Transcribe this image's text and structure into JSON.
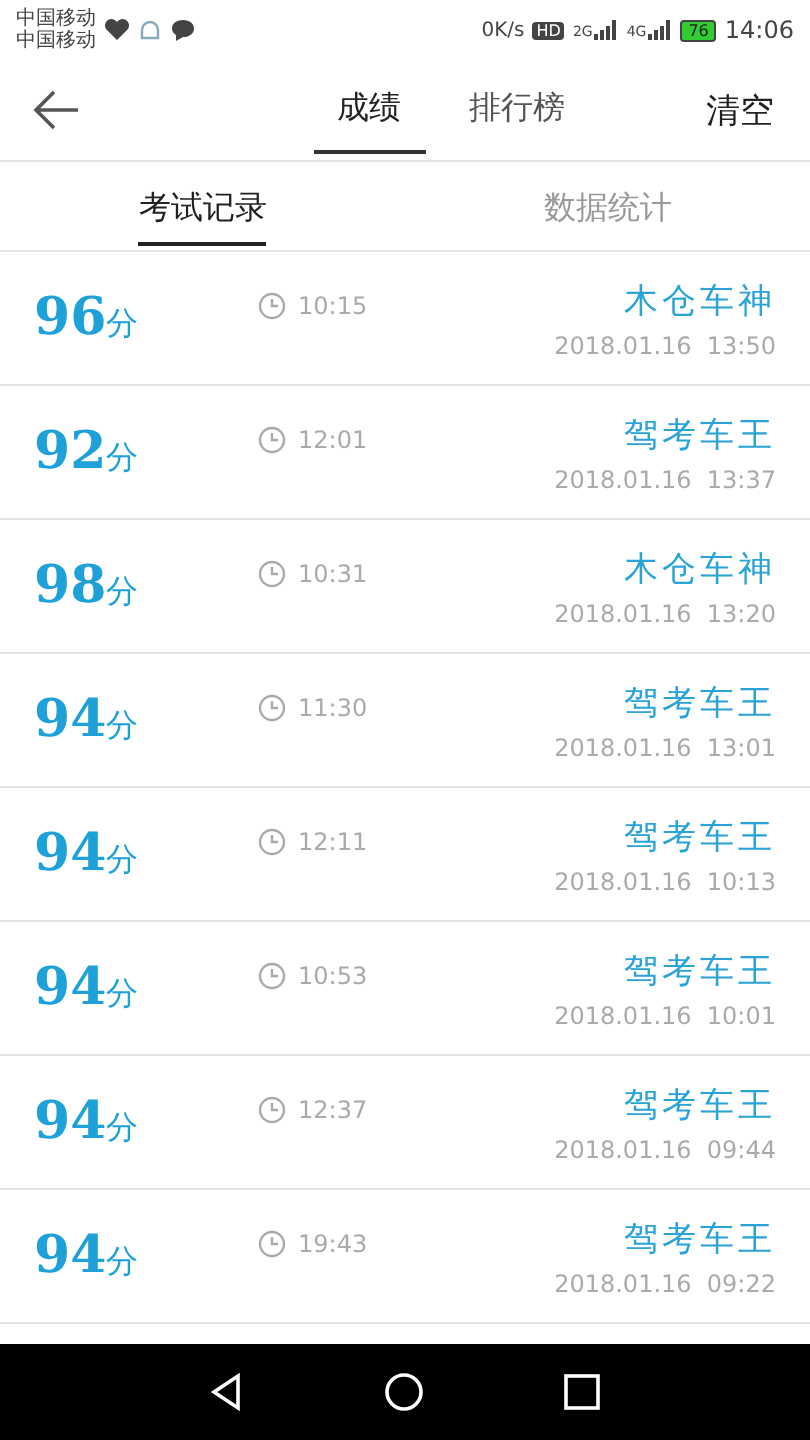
{
  "status_bar": {
    "carriers": [
      "中国移动",
      "中国移动"
    ],
    "speed": "0K/s",
    "hd": "HD",
    "signal_labels": [
      "2G",
      "4G"
    ],
    "battery": "76",
    "time": "14:06"
  },
  "header": {
    "tabs": [
      {
        "label": "成绩",
        "selected": true
      },
      {
        "label": "排行榜",
        "selected": false
      }
    ],
    "action": "清空"
  },
  "sub_tabs": [
    {
      "label": "考试记录",
      "selected": true
    },
    {
      "label": "数据统计",
      "selected": false
    }
  ],
  "records": [
    {
      "score": "96",
      "unit": "分",
      "duration": "10:15",
      "title": "木仓车神",
      "date": "2018.01.16  13:50"
    },
    {
      "score": "92",
      "unit": "分",
      "duration": "12:01",
      "title": "驾考车王",
      "date": "2018.01.16  13:37"
    },
    {
      "score": "98",
      "unit": "分",
      "duration": "10:31",
      "title": "木仓车神",
      "date": "2018.01.16  13:20"
    },
    {
      "score": "94",
      "unit": "分",
      "duration": "11:30",
      "title": "驾考车王",
      "date": "2018.01.16  13:01"
    },
    {
      "score": "94",
      "unit": "分",
      "duration": "12:11",
      "title": "驾考车王",
      "date": "2018.01.16  10:13"
    },
    {
      "score": "94",
      "unit": "分",
      "duration": "10:53",
      "title": "驾考车王",
      "date": "2018.01.16  10:01"
    },
    {
      "score": "94",
      "unit": "分",
      "duration": "12:37",
      "title": "驾考车王",
      "date": "2018.01.16  09:44"
    },
    {
      "score": "94",
      "unit": "分",
      "duration": "19:43",
      "title": "驾考车王",
      "date": "2018.01.16  09:22"
    }
  ]
}
